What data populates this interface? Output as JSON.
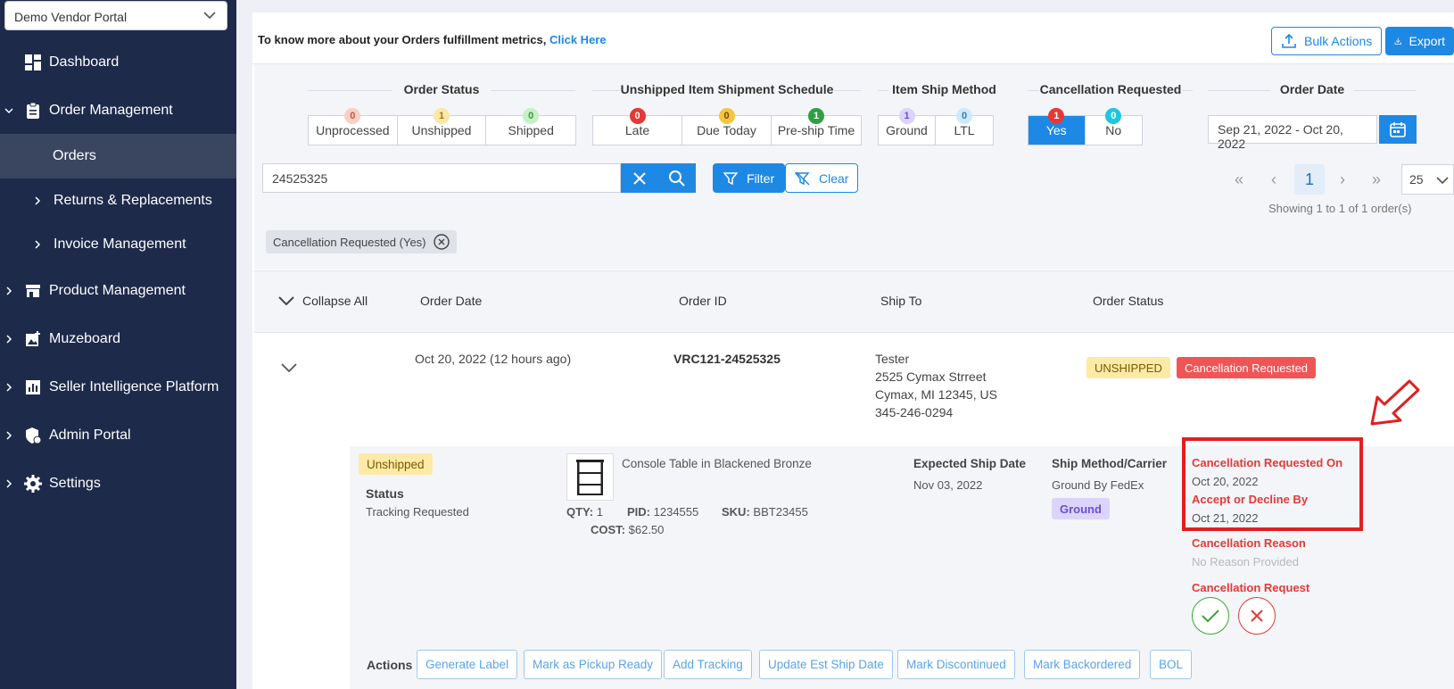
{
  "sidebar": {
    "vendor": "Demo Vendor Portal",
    "items": [
      {
        "label": "Dashboard"
      },
      {
        "label": "Order Management"
      },
      {
        "label": "Orders"
      },
      {
        "label": "Returns & Replacements"
      },
      {
        "label": "Invoice Management"
      },
      {
        "label": "Product Management"
      },
      {
        "label": "Muzeboard"
      },
      {
        "label": "Seller Intelligence Platform"
      },
      {
        "label": "Admin Portal"
      },
      {
        "label": "Settings"
      }
    ]
  },
  "header": {
    "metrics_text": "To know more about your Orders fulfillment metrics,",
    "metrics_link": "Click Here",
    "bulk_actions": "Bulk Actions",
    "export": "Export"
  },
  "filters": {
    "order_status": {
      "title": "Order Status",
      "cells": [
        {
          "label": "Unprocessed",
          "count": "0"
        },
        {
          "label": "Unshipped",
          "count": "1"
        },
        {
          "label": "Shipped",
          "count": "0"
        }
      ]
    },
    "schedule": {
      "title": "Unshipped Item Shipment Schedule",
      "cells": [
        {
          "label": "Late",
          "count": "0"
        },
        {
          "label": "Due Today",
          "count": "0"
        },
        {
          "label": "Pre-ship Time",
          "count": "1"
        }
      ]
    },
    "ship_method": {
      "title": "Item Ship Method",
      "cells": [
        {
          "label": "Ground",
          "count": "1"
        },
        {
          "label": "LTL",
          "count": "0"
        }
      ]
    },
    "cancellation": {
      "title": "Cancellation Requested",
      "cells": [
        {
          "label": "Yes",
          "count": "1"
        },
        {
          "label": "No",
          "count": "0"
        }
      ]
    },
    "order_date": {
      "title": "Order Date",
      "value": "Sep 21, 2022 - Oct 20, 2022"
    }
  },
  "search": {
    "value": "24525325",
    "filter_label": "Filter",
    "clear_label": "Clear"
  },
  "pagination": {
    "first": "«",
    "prev": "‹",
    "current": "1",
    "next": "›",
    "last": "»",
    "page_size": "25",
    "showing": "Showing 1 to 1 of 1 order(s)"
  },
  "active_filter_chip": "Cancellation Requested (Yes)",
  "table": {
    "collapse_all": "Collapse All",
    "headers": [
      "Order Date",
      "Order ID",
      "Ship To",
      "Order Status"
    ],
    "row": {
      "order_date": "Oct 20, 2022 (12 hours ago)",
      "order_id": "VRC121-24525325",
      "ship_to": [
        "Tester",
        "2525 Cymax Strreet",
        "Cymax, MI 12345, US",
        "345-246-0294"
      ],
      "status_badge": "UNSHIPPED",
      "cancel_badge": "Cancellation Requested"
    }
  },
  "detail": {
    "status_pill": "Unshipped",
    "status_label": "Status",
    "status_value": "Tracking Requested",
    "product_name": "Console Table in Blackened Bronze",
    "qty_label": "QTY:",
    "qty": "1",
    "pid_label": "PID:",
    "pid": "1234555",
    "sku_label": "SKU:",
    "sku": "BBT23455",
    "cost_label": "COST:",
    "cost": "$62.50",
    "expected_ship_label": "Expected Ship Date",
    "expected_ship_value": "Nov 03, 2022",
    "ship_method_label": "Ship Method/Carrier",
    "ship_method_value": "Ground By FedEx",
    "ship_method_pill": "Ground",
    "cancel_requested_on_label": "Cancellation Requested On",
    "cancel_requested_on_value": "Oct 20, 2022",
    "accept_by_label": "Accept or Decline By",
    "accept_by_value": "Oct 21, 2022",
    "cancel_reason_label": "Cancellation Reason",
    "cancel_reason_value": "No Reason Provided",
    "cancel_request_label": "Cancellation Request"
  },
  "actions": {
    "label": "Actions",
    "buttons": [
      "Generate Label",
      "Mark as Pickup Ready",
      "Add Tracking",
      "Update Est Ship Date",
      "Mark Discontinued",
      "Mark Backordered",
      "BOL"
    ]
  },
  "colors": {
    "primary": "#1e88e5",
    "sidebar": "#1e2a4a",
    "danger": "#e53935",
    "warning_bg": "#fdeaa7"
  }
}
